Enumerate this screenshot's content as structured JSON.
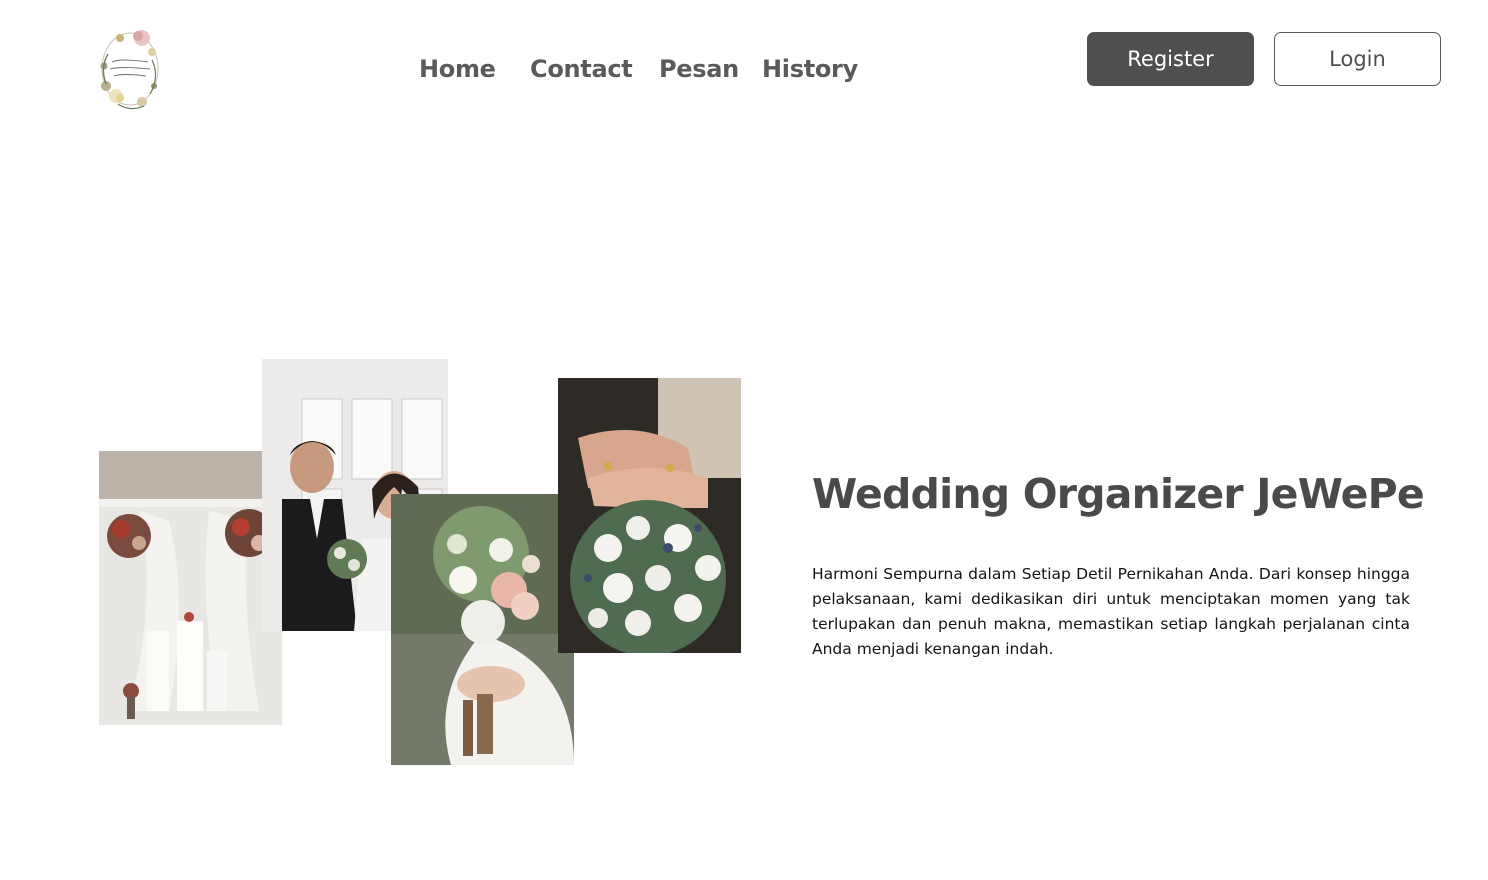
{
  "logo": {
    "icon": "floral-wreath-logo-icon",
    "lettering": "Wedding Organizer JeWePe"
  },
  "nav": {
    "home": "Home",
    "contact": "Contact",
    "pesan": "Pesan",
    "history": "History"
  },
  "auth": {
    "register_label": "Register",
    "login_label": "Login"
  },
  "hero": {
    "title": "Wedding Organizer JeWePe",
    "description": "Harmoni Sempurna dalam Setiap Detil Pernikahan Anda. Dari konsep hingga pelaksanaan, kami dedikasikan diri untuk menciptakan momen yang tak terlupakan dan penuh makna, memastikan setiap langkah perjalanan cinta Anda menjadi kenangan indah."
  },
  "gallery": [
    {
      "icon": "wedding-decor-photo"
    },
    {
      "icon": "bride-groom-photo"
    },
    {
      "icon": "bridal-bouquet-photo"
    },
    {
      "icon": "rings-cotton-bouquet-photo"
    }
  ],
  "colors": {
    "primary_button": "#4f4f4f",
    "text_dark": "#4a4a4a",
    "background": "#ffffff"
  }
}
